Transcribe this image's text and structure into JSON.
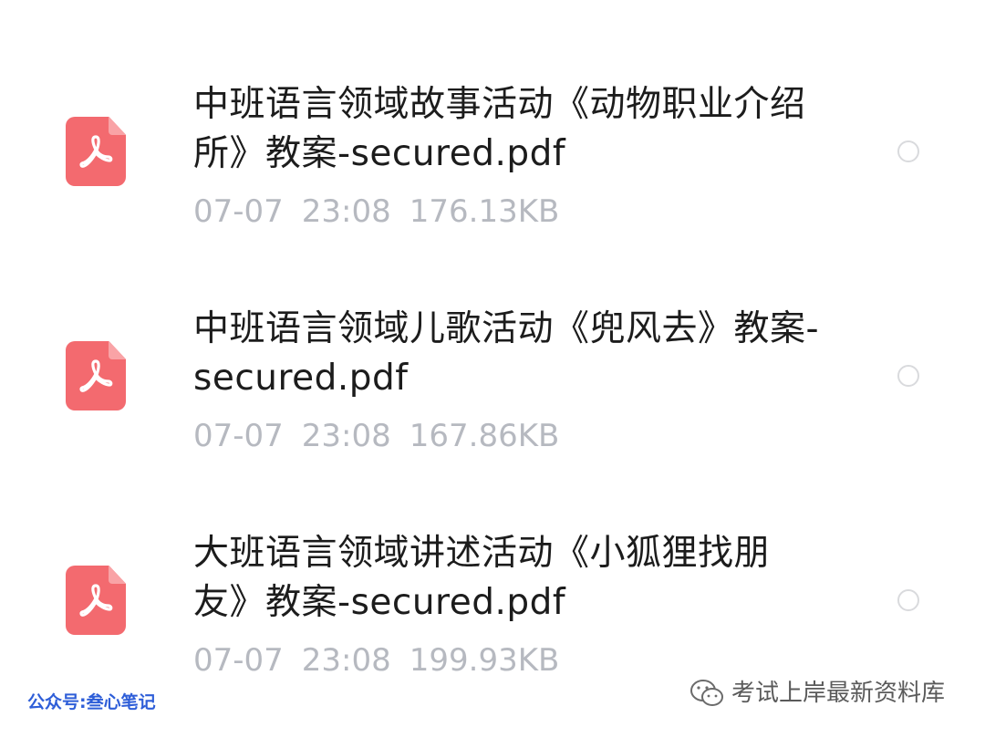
{
  "files": [
    {
      "name": "中班语言领域故事活动《动物职业介绍所》教案-secured.pdf",
      "date": "07-07",
      "time": "23:08",
      "size": "176.13KB",
      "icon": "pdf-icon",
      "selected": false
    },
    {
      "name": "中班语言领域儿歌活动《兜风去》教案-secured.pdf",
      "date": "07-07",
      "time": "23:08",
      "size": "167.86KB",
      "icon": "pdf-icon",
      "selected": false
    },
    {
      "name": "大班语言领域讲述活动《小狐狸找朋友》教案-secured.pdf",
      "date": "07-07",
      "time": "23:08",
      "size": "199.93KB",
      "icon": "pdf-icon",
      "selected": false
    }
  ],
  "watermark": {
    "left_text": "公众号:叁心笔记",
    "right_text": "考试上岸最新资料库",
    "right_icon": "wechat-icon"
  },
  "colors": {
    "pdf_icon": "#f36a6f",
    "name_text": "#1c1c1c",
    "meta_text": "#b6b9c0",
    "watermark_left": "#2e5ed8"
  }
}
